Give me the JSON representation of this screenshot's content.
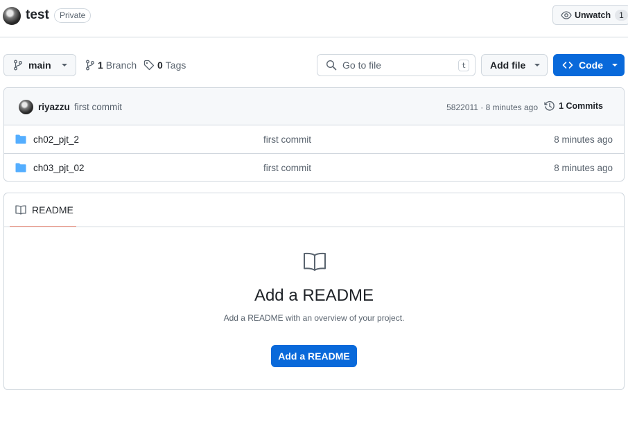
{
  "repo": {
    "name": "test",
    "visibility": "Private",
    "watch_label": "Unwatch",
    "watch_count": "1"
  },
  "toolbar": {
    "branch": "main",
    "branches_count": "1",
    "branches_label": "Branch",
    "tags_count": "0",
    "tags_label": "Tags",
    "search_placeholder": "Go to file",
    "search_shortcut": "t",
    "add_file_label": "Add file",
    "code_label": "Code"
  },
  "latest_commit": {
    "author": "riyazzu",
    "message": "first commit",
    "hash_time": "5822011 · 8 minutes ago",
    "commits_label": "1 Commits"
  },
  "files": [
    {
      "name": "ch02_pjt_2",
      "commit": "first commit",
      "time": "8 minutes ago"
    },
    {
      "name": "ch03_pjt_02",
      "commit": "first commit",
      "time": "8 minutes ago"
    }
  ],
  "readme": {
    "tab_label": "README",
    "heading": "Add a README",
    "subtext": "Add a README with an overview of your project.",
    "button_label": "Add a README"
  },
  "colors": {
    "accent": "#0969da",
    "folder": "#54aeff",
    "tab_underline": "#fd8c73",
    "border": "#d0d7de"
  }
}
